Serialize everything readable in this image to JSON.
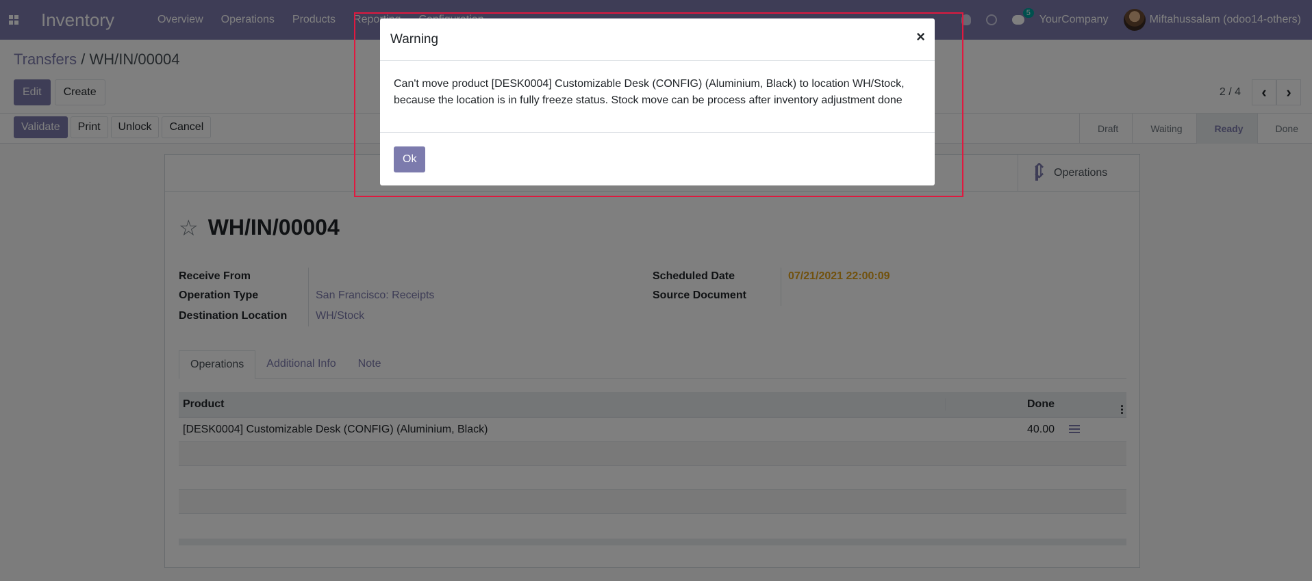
{
  "navbar": {
    "app_name": "Inventory",
    "menu": [
      "Overview",
      "Operations",
      "Products",
      "Reporting",
      "Configuration"
    ],
    "chat_count": "5",
    "company": "YourCompany",
    "user": "Miftahussalam (odoo14-others)"
  },
  "breadcrumb": {
    "parent": "Transfers",
    "separator": "/",
    "current": "WH/IN/00004"
  },
  "control_panel": {
    "edit_label": "Edit",
    "create_label": "Create",
    "pager_value": "2 / 4"
  },
  "statusbar": {
    "buttons": [
      "Validate",
      "Print",
      "Unlock",
      "Cancel"
    ],
    "stages": [
      "Draft",
      "Waiting",
      "Ready",
      "Done"
    ],
    "active_stage": "Ready"
  },
  "record": {
    "smart_button_label": "Operations",
    "title": "WH/IN/00004",
    "fields_left": [
      {
        "label": "Receive From",
        "value": ""
      },
      {
        "label": "Operation Type",
        "value": "San Francisco: Receipts"
      },
      {
        "label": "Destination Location",
        "value": "WH/Stock"
      }
    ],
    "fields_right": [
      {
        "label": "Scheduled Date",
        "value": "07/21/2021 22:00:09"
      },
      {
        "label": "Source Document",
        "value": ""
      }
    ],
    "tabs": [
      "Operations",
      "Additional Info",
      "Note"
    ],
    "table": {
      "headers": [
        "Product",
        "Done"
      ],
      "rows": [
        {
          "product": "[DESK0004] Customizable Desk (CONFIG) (Aluminium, Black)",
          "done": "40.00"
        }
      ]
    }
  },
  "modal": {
    "title": "Warning",
    "close": "×",
    "message_line1": "Can't move product [DESK0004] Customizable Desk (CONFIG) (Aluminium, Black) to location WH/Stock,",
    "message_line2": "because the location is in fully freeze status. Stock move can be process after inventory adjustment done",
    "ok_label": "Ok"
  },
  "colors": {
    "brand": "#7c7bad",
    "highlight": "#e0193f",
    "date": "#e3a21a",
    "badge": "#00a09d"
  }
}
